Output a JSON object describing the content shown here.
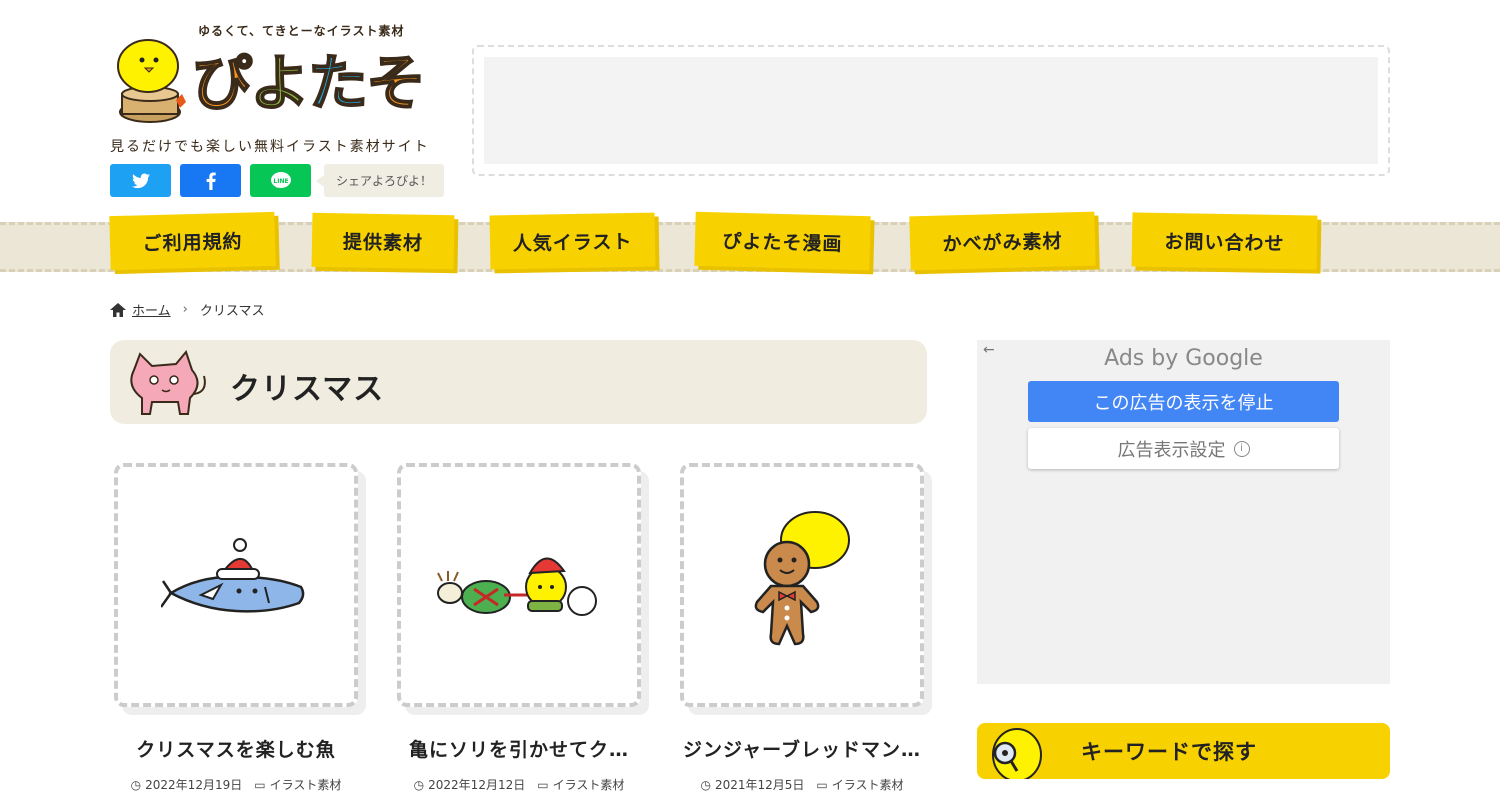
{
  "header": {
    "tagline_top": "ゆるくて、てきとーなイラスト素材",
    "logo_text": "ぴよたそ",
    "logo_colors": [
      "#f7941d",
      "#8cc63f",
      "#29abe2",
      "#f7941d"
    ],
    "site_description": "見るだけでも楽しい無料イラスト素材サイト",
    "share": {
      "twitter_icon": "twitter-icon",
      "facebook_icon": "facebook-icon",
      "line_icon": "line-icon",
      "share_text": "シェアよろぴよ！"
    }
  },
  "nav": {
    "items": [
      {
        "label": "ご利用規約"
      },
      {
        "label": "提供素材"
      },
      {
        "label": "人気イラスト"
      },
      {
        "label": "ぴよたそ漫画"
      },
      {
        "label": "かべがみ素材"
      },
      {
        "label": "お問い合わせ"
      }
    ],
    "accent": "#f8d200"
  },
  "breadcrumb": {
    "home": "ホーム",
    "current": "クリスマス"
  },
  "category": {
    "title": "クリスマス"
  },
  "cards": [
    {
      "title": "クリスマスを楽しむ魚",
      "date": "2022年12月19日",
      "category": "イラスト素材"
    },
    {
      "title": "亀にソリを引かせてク…",
      "date": "2022年12月12日",
      "category": "イラスト素材"
    },
    {
      "title": "ジンジャーブレッドマン…",
      "date": "2021年12月5日",
      "category": "イラスト素材"
    }
  ],
  "sidebar": {
    "ad": {
      "ads_by": "Ads by ",
      "google": "Google",
      "stop_label": "この広告の表示を停止",
      "settings_label": "広告表示設定"
    },
    "keyword_search_label": "キーワードで探す"
  }
}
